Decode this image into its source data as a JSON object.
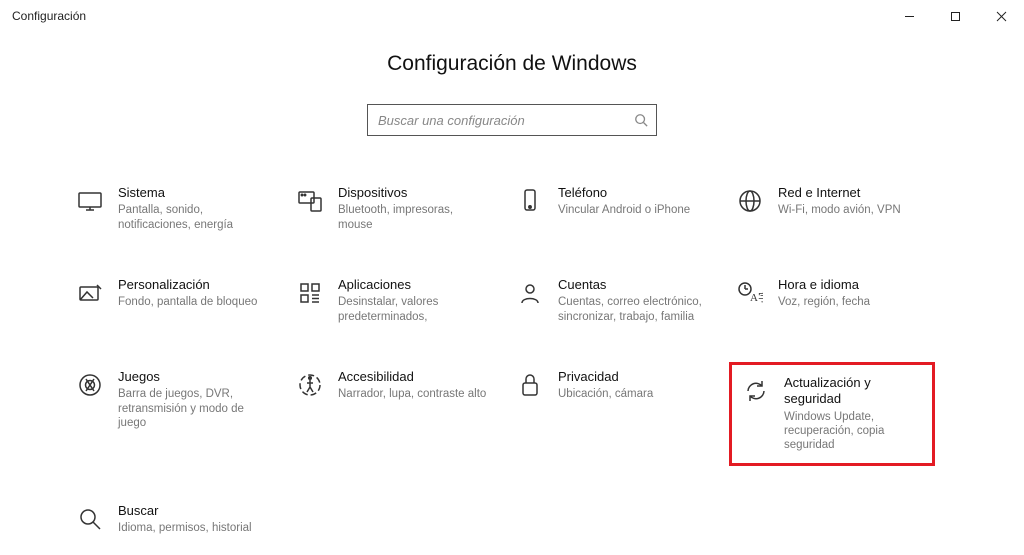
{
  "window": {
    "title": "Configuración"
  },
  "page_title": "Configuración de Windows",
  "search": {
    "placeholder": "Buscar una configuración"
  },
  "tiles": [
    {
      "title": "Sistema",
      "sub": "Pantalla, sonido, notificaciones, energía"
    },
    {
      "title": "Dispositivos",
      "sub": "Bluetooth, impresoras, mouse"
    },
    {
      "title": "Teléfono",
      "sub": "Vincular Android o iPhone"
    },
    {
      "title": "Red e Internet",
      "sub": "Wi-Fi, modo avión, VPN"
    },
    {
      "title": "Personalización",
      "sub": "Fondo, pantalla de bloqueo"
    },
    {
      "title": "Aplicaciones",
      "sub": "Desinstalar, valores predeterminados,"
    },
    {
      "title": "Cuentas",
      "sub": "Cuentas, correo electrónico, sincronizar, trabajo, familia"
    },
    {
      "title": "Hora e idioma",
      "sub": "Voz, región, fecha"
    },
    {
      "title": "Juegos",
      "sub": "Barra de juegos, DVR, retransmisión y modo de juego"
    },
    {
      "title": "Accesibilidad",
      "sub": "Narrador, lupa, contraste alto"
    },
    {
      "title": "Privacidad",
      "sub": "Ubicación, cámara"
    },
    {
      "title": "Actualización y seguridad",
      "sub": "Windows Update, recuperación, copia seguridad"
    },
    {
      "title": "Buscar",
      "sub": "Idioma, permisos, historial"
    }
  ]
}
